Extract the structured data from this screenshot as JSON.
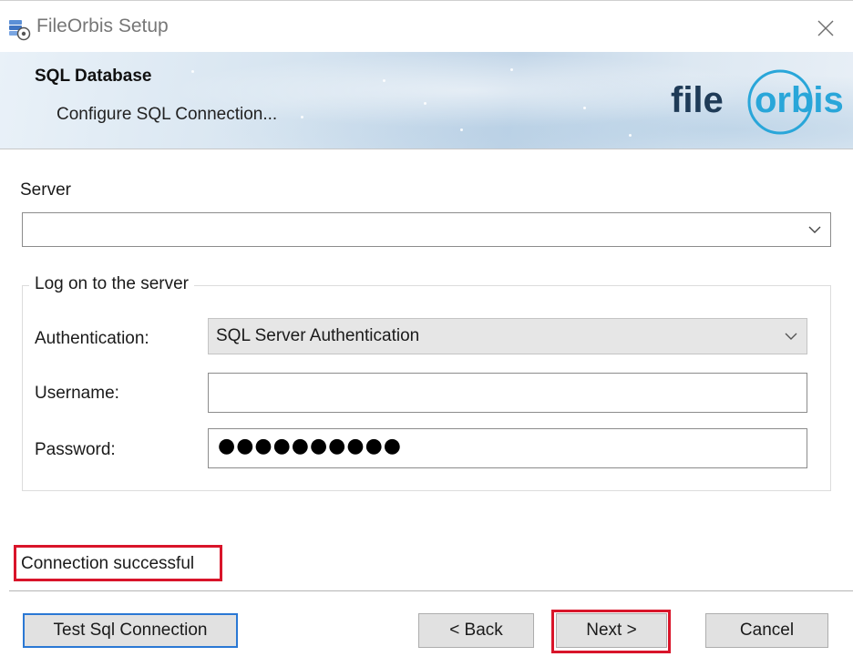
{
  "window": {
    "title": "FileOrbis Setup",
    "icon": "setup-installer-icon",
    "close_icon": "close-icon"
  },
  "banner": {
    "title": "SQL Database",
    "subtitle": "Configure SQL Connection...",
    "logo": {
      "prefix": "file",
      "suffix": "orbis",
      "text_color": "#1f3b57",
      "accent_color": "#29a6d9"
    }
  },
  "server": {
    "label": "Server",
    "value": ""
  },
  "logon": {
    "group_title": "Log on to the server",
    "authentication_label": "Authentication:",
    "authentication_value": "SQL Server Authentication",
    "username_label": "Username:",
    "username_value": "",
    "password_label": "Password:",
    "password_masked": "●●●●●●●●●●"
  },
  "status": {
    "message": "Connection successful",
    "highlight_color": "#d9152a"
  },
  "buttons": {
    "test": "Test Sql Connection",
    "back": "< Back",
    "next": "Next >",
    "cancel": "Cancel"
  },
  "colors": {
    "default_button_border": "#2a78d4",
    "annotation_red": "#d9152a"
  }
}
